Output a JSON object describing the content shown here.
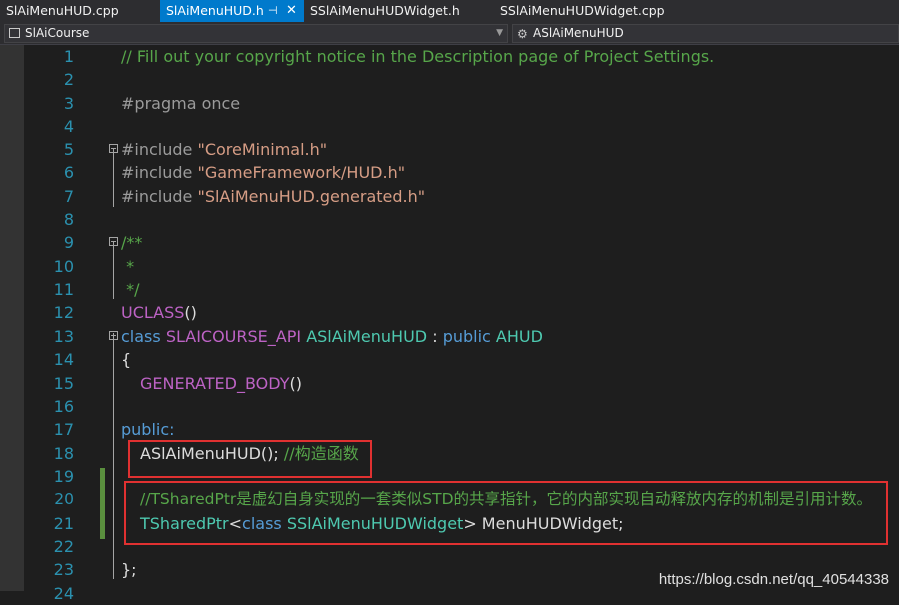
{
  "tabs": [
    {
      "label": "SlAiMenuHUD.cpp",
      "active": false
    },
    {
      "label": "SlAiMenuHUD.h",
      "active": true,
      "pin": "⊣",
      "close": "✕"
    },
    {
      "label": "SSlAiMenuHUDWidget.h",
      "active": false
    },
    {
      "label": "SSlAiMenuHUDWidget.cpp",
      "active": false
    }
  ],
  "nav": {
    "project": "SlAiCourse",
    "member": "ASlAiMenuHUD"
  },
  "code": {
    "l1": "// Fill out your copyright notice in the Description page of Project Settings.",
    "l3": "#pragma once",
    "l5_inc": "#include",
    "l5_file": "\"CoreMinimal.h\"",
    "l6_inc": "#include",
    "l6_file": "\"GameFramework/HUD.h\"",
    "l7_inc": "#include",
    "l7_file": "\"SlAiMenuHUD.generated.h\"",
    "l9": "/**",
    "l10": " *",
    "l11": " */",
    "l12_macro": "UCLASS",
    "l12_paren": "()",
    "l13_class": "class",
    "l13_api": "SLAICOURSE_API",
    "l13_name": "ASlAiMenuHUD",
    "l13_colon": " : ",
    "l13_public": "public",
    "l13_base": "AHUD",
    "l14": "{",
    "l15_macro": "GENERATED_BODY",
    "l15_paren": "()",
    "l17": "public:",
    "l18_code": "ASlAiMenuHUD();",
    "l18_comment": "//构造函数",
    "l20": "//TSharedPtr是虚幻自身实现的一套类似STD的共享指针，它的内部实现自动释放内存的机制是引用计数。",
    "l21_type": "TSharedPtr",
    "l21_lt": "<",
    "l21_class": "class",
    "l21_widget": "SSlAiMenuHUDWidget",
    "l21_rest": "> MenuHUDWidget;",
    "l23": "};"
  },
  "line_numbers": [
    "1",
    "2",
    "3",
    "4",
    "5",
    "6",
    "7",
    "8",
    "9",
    "10",
    "11",
    "12",
    "13",
    "14",
    "15",
    "16",
    "17",
    "18",
    "19",
    "20",
    "21",
    "22",
    "23",
    "24"
  ],
  "watermark": "https://blog.csdn.net/qq_40544338",
  "colors": {
    "accent": "#007acc",
    "comment": "#57a64a",
    "keyword": "#569cd6",
    "string": "#d69d85",
    "macro": "#bd63c5",
    "type": "#4ec9b0",
    "highlight_box": "#e03131"
  }
}
